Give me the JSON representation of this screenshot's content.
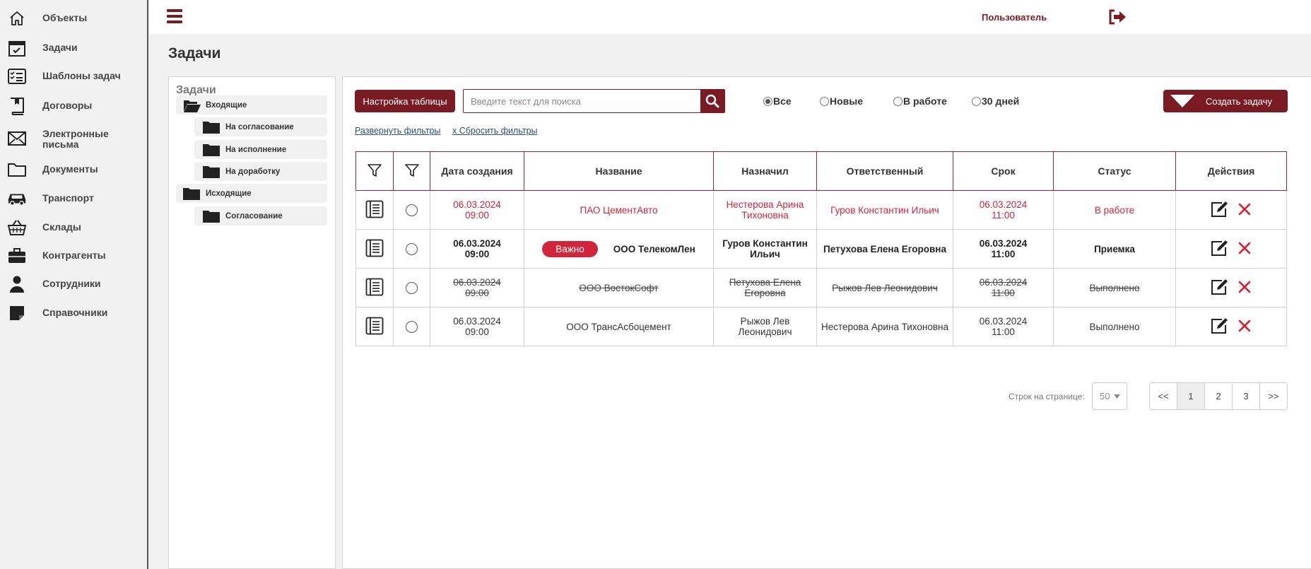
{
  "sidebar": {
    "items": [
      {
        "label": "Объекты",
        "icon": "home-icon"
      },
      {
        "label": "Задачи",
        "icon": "calendar-check-icon"
      },
      {
        "label": "Шаблоны задач",
        "icon": "checklist-icon"
      },
      {
        "label": "Договоры",
        "icon": "bookmark-book-icon"
      },
      {
        "label": "Электронные письма",
        "icon": "envelope-icon"
      },
      {
        "label": "Документы",
        "icon": "folder-icon"
      },
      {
        "label": "Транспорт",
        "icon": "car-icon"
      },
      {
        "label": "Склады",
        "icon": "basket-icon"
      },
      {
        "label": "Контрагенты",
        "icon": "briefcase-icon"
      },
      {
        "label": "Сотрудники",
        "icon": "person-icon"
      },
      {
        "label": "Справочники",
        "icon": "sticky-note-icon"
      }
    ]
  },
  "header": {
    "user": "Пользователь"
  },
  "page": {
    "title": "Задачи"
  },
  "tree": {
    "title": "Задачи",
    "items": [
      {
        "label": "Входящие",
        "level": 0,
        "open": true
      },
      {
        "label": "На согласование",
        "level": 1
      },
      {
        "label": "На исполнение",
        "level": 1
      },
      {
        "label": "На доработку",
        "level": 1
      },
      {
        "label": "Исходящие",
        "level": 0
      },
      {
        "label": "Согласование",
        "level": 1
      }
    ]
  },
  "toolbar": {
    "table_settings": "Настройка таблицы",
    "search_placeholder": "Введите текст для поиска",
    "filters": [
      "Все",
      "Новые",
      "В работе",
      "30 дней"
    ],
    "selected_filter": "Все",
    "create": "Создать задачу",
    "expand_filters": "Развернуть фильтры",
    "reset_filters": "x Сбросить фильтры"
  },
  "table": {
    "headers": [
      "Дата создания",
      "Название",
      "Назначил",
      "Ответственный",
      "Срок",
      "Статус",
      "Действия"
    ],
    "rows": [
      {
        "style": "red",
        "created": [
          "06.03.2024",
          "09:00"
        ],
        "badge": "",
        "name": "ПАО ЦементАвто",
        "assigned_by": [
          "Нестерова Арина",
          "Тихоновна"
        ],
        "responsible": "Гуров Константин Ильич",
        "due": [
          "06.03.2024",
          "11:00"
        ],
        "status": "В работе"
      },
      {
        "style": "bold",
        "created": [
          "06.03.2024",
          "09:00"
        ],
        "badge": "Важно",
        "name": "ООО ТелекомЛен",
        "assigned_by": [
          "Гуров Константин",
          "Ильич"
        ],
        "responsible": "Петухова Елена Егоровна",
        "due": [
          "06.03.2024",
          "11:00"
        ],
        "status": "Приемка"
      },
      {
        "style": "strike",
        "created": [
          "06.03.2024",
          "09:00"
        ],
        "badge": "",
        "name": "ООО ВостокСофт",
        "assigned_by": [
          "Петухова Елена",
          "Егоровна"
        ],
        "responsible": "Рыжов Лев Леонидович",
        "due": [
          "06.03.2024",
          "11:00"
        ],
        "status": "Выполнено"
      },
      {
        "style": "plain",
        "created": [
          "06.03.2024",
          "09:00"
        ],
        "badge": "",
        "name": "ООО ТрансАсбоцемент",
        "assigned_by": [
          "Рыжов Лев",
          "Леонидович"
        ],
        "responsible": "Нестерова Арина Тихоновна",
        "due": [
          "06.03.2024",
          "11:00"
        ],
        "status": "Выполнено"
      }
    ]
  },
  "pagination": {
    "rows_label": "Строк на странице:",
    "per_page": "50",
    "pages": [
      "<<",
      "1",
      "2",
      "3",
      ">>"
    ],
    "current": "1"
  },
  "colors": {
    "brand": "#7a1b24",
    "accent_red": "#d2243b",
    "link": "#2c4e74"
  }
}
